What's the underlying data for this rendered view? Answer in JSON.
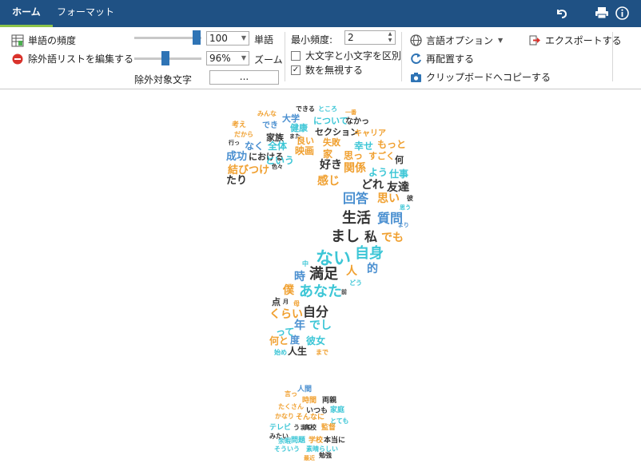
{
  "tabs": [
    {
      "label": "ホーム",
      "active": true
    },
    {
      "label": "フォーマット",
      "active": false
    }
  ],
  "ribbon": {
    "word_frequency_label": "単語の頻度",
    "edit_exclusion_label": "除外語リストを編集する",
    "word_count_value": "100",
    "word_count_label": "単語",
    "zoom_value": "96%",
    "zoom_label": "ズーム",
    "exclude_chars_label": "除外対象文字",
    "exclude_chars_button": "...",
    "min_frequency_label": "最小頻度:",
    "min_frequency_value": "2",
    "case_sensitive_label": "大文字と小文字を区別",
    "case_sensitive_checked": false,
    "ignore_numbers_label": "数を無視する",
    "ignore_numbers_checked": true,
    "language_options_label": "言語オプション",
    "rearrange_label": "再配置する",
    "copy_clipboard_label": "クリップボードへコピーする",
    "export_label": "エクスポートする",
    "word_count_slider_pct": 0.95,
    "zoom_slider_pct": 0.45
  },
  "colors": {
    "blue": "#4a8fd0",
    "orange": "#f0a030",
    "teal": "#3cc6d6",
    "dark": "#333333",
    "accent_bar": "#1f5184",
    "tab_underline": "#8cc34a"
  },
  "cloud_words": [
    {
      "text": "できる",
      "color": "dark"
    },
    {
      "text": "ところ",
      "color": "teal"
    },
    {
      "text": "みんな",
      "color": "orange"
    },
    {
      "text": "一番",
      "color": "orange"
    },
    {
      "text": "大学",
      "color": "blue"
    },
    {
      "text": "について",
      "color": "teal"
    },
    {
      "text": "なかっ",
      "color": "dark"
    },
    {
      "text": "考え",
      "color": "orange"
    },
    {
      "text": "だから",
      "color": "orange"
    },
    {
      "text": "でき",
      "color": "blue"
    },
    {
      "text": "健康",
      "color": "teal"
    },
    {
      "text": "セクション",
      "color": "dark"
    },
    {
      "text": "家族",
      "color": "dark"
    },
    {
      "text": "また",
      "color": "dark"
    },
    {
      "text": "良い",
      "color": "orange"
    },
    {
      "text": "キャリア",
      "color": "orange"
    },
    {
      "text": "行っ",
      "color": "dark"
    },
    {
      "text": "なく",
      "color": "blue"
    },
    {
      "text": "全体",
      "color": "teal"
    },
    {
      "text": "失敗",
      "color": "orange"
    },
    {
      "text": "幸せ",
      "color": "teal"
    },
    {
      "text": "もっと",
      "color": "orange"
    },
    {
      "text": "成功",
      "color": "blue"
    },
    {
      "text": "における",
      "color": "dark"
    },
    {
      "text": "映画",
      "color": "orange"
    },
    {
      "text": "家",
      "color": "orange"
    },
    {
      "text": "思っ",
      "color": "orange"
    },
    {
      "text": "すごく",
      "color": "orange"
    },
    {
      "text": "何",
      "color": "dark"
    },
    {
      "text": "結びつけ",
      "color": "orange"
    },
    {
      "text": "色々",
      "color": "dark"
    },
    {
      "text": "という",
      "color": "teal"
    },
    {
      "text": "好き",
      "color": "dark"
    },
    {
      "text": "関係",
      "color": "orange"
    },
    {
      "text": "よう",
      "color": "teal"
    },
    {
      "text": "仕事",
      "color": "teal"
    },
    {
      "text": "たり",
      "color": "dark"
    },
    {
      "text": "感じ",
      "color": "orange"
    },
    {
      "text": "どれ",
      "color": "dark"
    },
    {
      "text": "友達",
      "color": "dark"
    },
    {
      "text": "回答",
      "color": "blue"
    },
    {
      "text": "思い",
      "color": "orange"
    },
    {
      "text": "彼",
      "color": "dark"
    },
    {
      "text": "思う",
      "color": "teal"
    },
    {
      "text": "生活",
      "color": "dark"
    },
    {
      "text": "質問",
      "color": "blue"
    },
    {
      "text": "より",
      "color": "blue"
    },
    {
      "text": "まし",
      "color": "dark"
    },
    {
      "text": "私",
      "color": "dark"
    },
    {
      "text": "でも",
      "color": "orange"
    },
    {
      "text": "自身",
      "color": "teal"
    },
    {
      "text": "ない",
      "color": "teal"
    },
    {
      "text": "中",
      "color": "teal"
    },
    {
      "text": "人",
      "color": "orange"
    },
    {
      "text": "的",
      "color": "blue"
    },
    {
      "text": "時",
      "color": "blue"
    },
    {
      "text": "満足",
      "color": "dark"
    },
    {
      "text": "どう",
      "color": "teal"
    },
    {
      "text": "僕",
      "color": "orange"
    },
    {
      "text": "あなた",
      "color": "teal"
    },
    {
      "text": "前",
      "color": "dark"
    },
    {
      "text": "点",
      "color": "dark"
    },
    {
      "text": "月",
      "color": "dark"
    },
    {
      "text": "母",
      "color": "orange"
    },
    {
      "text": "自分",
      "color": "dark"
    },
    {
      "text": "くらい",
      "color": "orange"
    },
    {
      "text": "年",
      "color": "blue"
    },
    {
      "text": "でし",
      "color": "teal"
    },
    {
      "text": "って",
      "color": "teal"
    },
    {
      "text": "何と",
      "color": "orange"
    },
    {
      "text": "度",
      "color": "blue"
    },
    {
      "text": "彼女",
      "color": "teal"
    },
    {
      "text": "始め",
      "color": "teal"
    },
    {
      "text": "人生",
      "color": "dark"
    },
    {
      "text": "まで",
      "color": "orange"
    },
    {
      "text": "人間",
      "color": "blue"
    },
    {
      "text": "言っ",
      "color": "orange"
    },
    {
      "text": "時間",
      "color": "orange"
    },
    {
      "text": "両親",
      "color": "dark"
    },
    {
      "text": "たくさん",
      "color": "orange"
    },
    {
      "text": "いつも",
      "color": "dark"
    },
    {
      "text": "家庭",
      "color": "teal"
    },
    {
      "text": "かなり",
      "color": "orange"
    },
    {
      "text": "そんなに",
      "color": "orange"
    },
    {
      "text": "とても",
      "color": "teal"
    },
    {
      "text": "テレビ",
      "color": "teal"
    },
    {
      "text": "うまく",
      "color": "dark"
    },
    {
      "text": "高校",
      "color": "dark"
    },
    {
      "text": "監督",
      "color": "orange"
    },
    {
      "text": "みたい",
      "color": "dark"
    },
    {
      "text": "余暇",
      "color": "teal"
    },
    {
      "text": "問題",
      "color": "teal"
    },
    {
      "text": "学校",
      "color": "orange"
    },
    {
      "text": "本当に",
      "color": "dark"
    },
    {
      "text": "そういう",
      "color": "teal"
    },
    {
      "text": "素晴らしい",
      "color": "teal"
    },
    {
      "text": "最近",
      "color": "orange"
    },
    {
      "text": "勉強",
      "color": "dark"
    }
  ]
}
